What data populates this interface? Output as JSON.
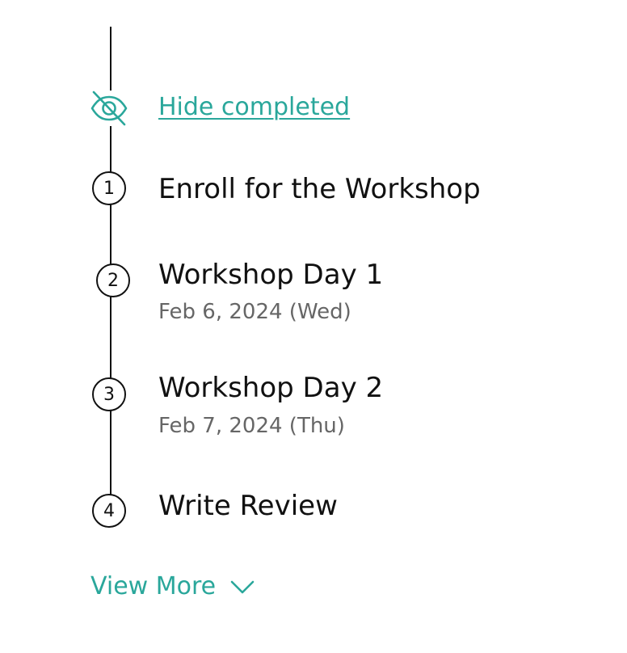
{
  "header": {
    "hide_completed_label": "Hide completed",
    "hide_icon": "eye-off-icon"
  },
  "steps": [
    {
      "number": "1",
      "title": "Enroll for the Workshop",
      "date": ""
    },
    {
      "number": "2",
      "title": "Workshop Day 1",
      "date": "Feb 6, 2024 (Wed)"
    },
    {
      "number": "3",
      "title": "Workshop Day 2",
      "date": "Feb 7, 2024 (Thu)"
    },
    {
      "number": "4",
      "title": "Write Review",
      "date": ""
    }
  ],
  "footer": {
    "view_more_label": "View More",
    "view_more_icon": "chevron-down-icon"
  },
  "colors": {
    "accent": "#2aa79b",
    "text": "#111111",
    "muted": "#666666",
    "line": "#111111"
  }
}
